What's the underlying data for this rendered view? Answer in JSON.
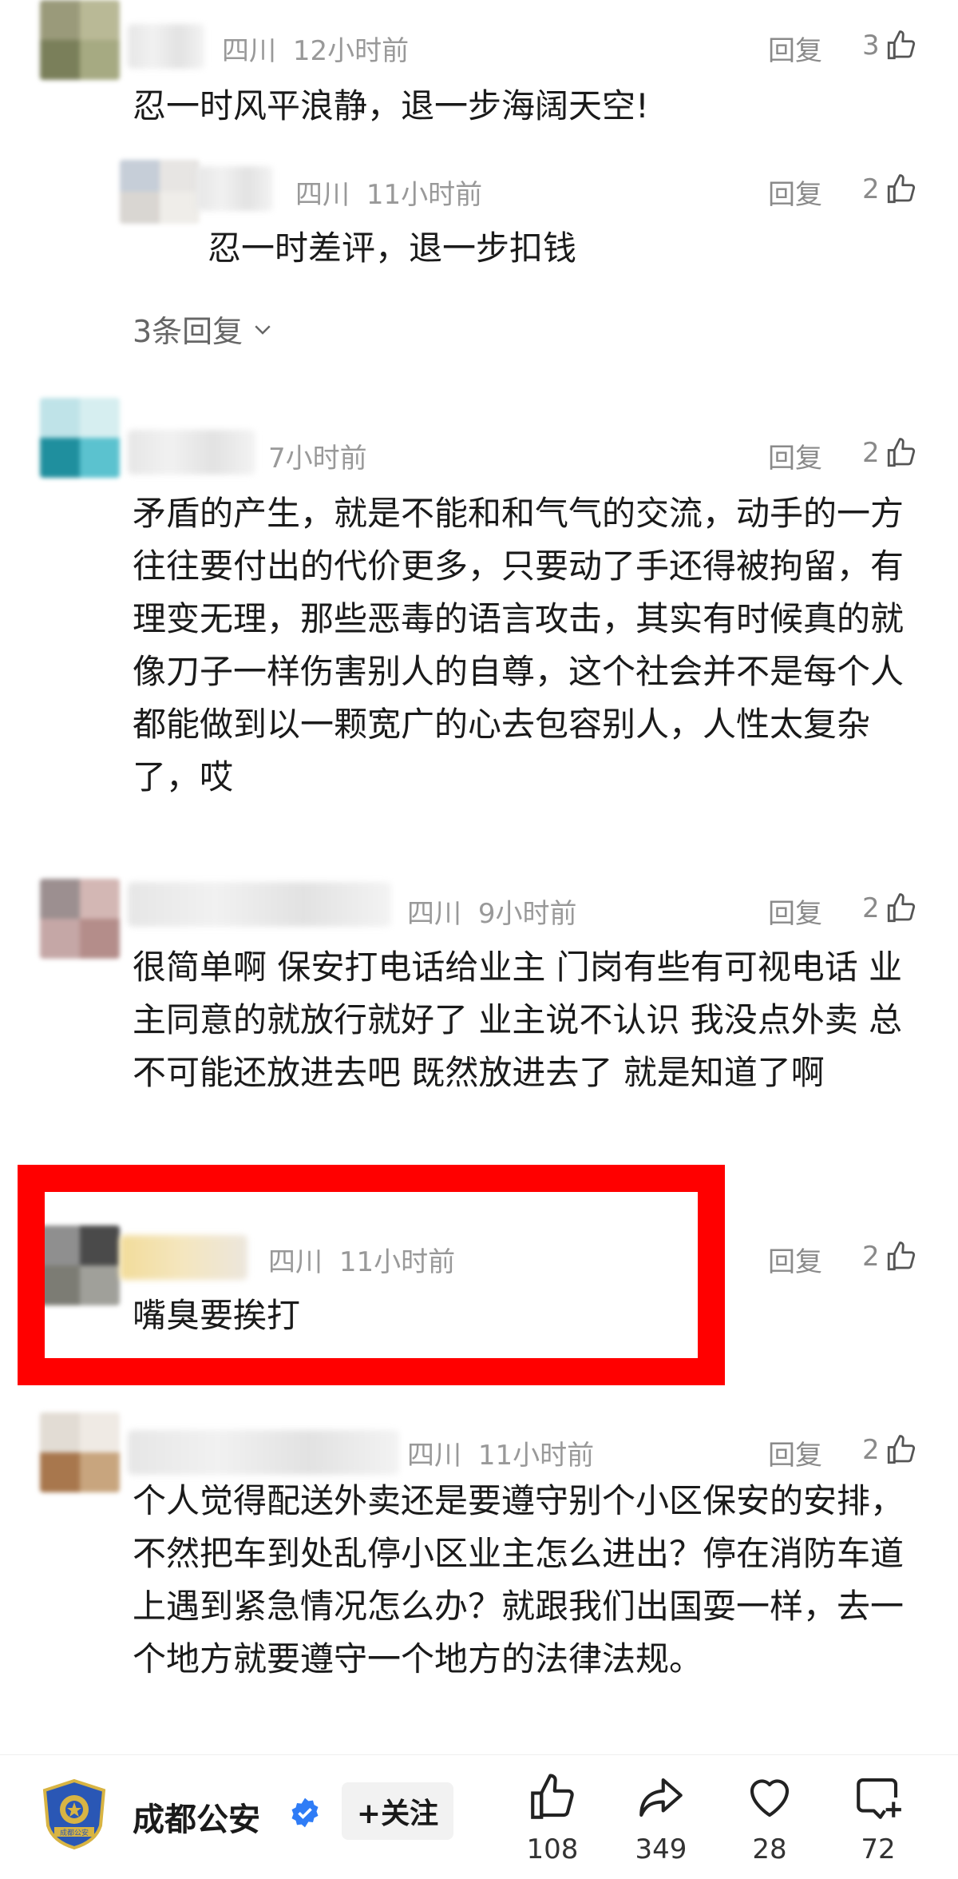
{
  "comments": [
    {
      "location": "四川",
      "time": "12小时前",
      "reply": "回复",
      "likes": "3",
      "text": "忍一时风平浪静，退一步海阔天空!"
    },
    {
      "location": "四川",
      "time": "11小时前",
      "reply": "回复",
      "likes": "2",
      "text": "忍一时差评，退一步扣钱"
    },
    {
      "location": "",
      "time": "7小时前",
      "reply": "回复",
      "likes": "2",
      "text": "矛盾的产生，就是不能和和气气的交流，动手的一方往往要付出的代价更多，只要动了手还得被拘留，有理变无理，那些恶毒的语言攻击，其实有时候真的就像刀子一样伤害别人的自尊，这个社会并不是每个人都能做到以一颗宽广的心去包容别人，人性太复杂了，哎"
    },
    {
      "location": "四川",
      "time": "9小时前",
      "reply": "回复",
      "likes": "2",
      "text": "很简单啊 保安打电话给业主 门岗有些有可视电话 业主同意的就放行就好了 业主说不认识 我没点外卖 总不可能还放进去吧 既然放进去了 就是知道了啊"
    },
    {
      "location": "四川",
      "time": "11小时前",
      "reply": "回复",
      "likes": "2",
      "text": "嘴臭要挨打"
    },
    {
      "location": "四川",
      "time": "11小时前",
      "reply": "回复",
      "likes": "2",
      "text": "个人觉得配送外卖还是要遵守别个小区保安的安排，不然把车到处乱停小区业主怎么进出？停在消防车道上遇到紧急情况怎么办？就跟我们出国耍一样，去一个地方就要遵守一个地方的法律法规。"
    }
  ],
  "more_replies": "3条回复",
  "account": {
    "name": "成都公安",
    "follow": "+关注",
    "logo_text": "成都公安"
  },
  "actions": {
    "like": "108",
    "share": "349",
    "favorite": "28",
    "comment": "72"
  },
  "colors": {
    "highlight": "#ff0000",
    "meta": "#999999",
    "verified": "#2f7cf6"
  }
}
